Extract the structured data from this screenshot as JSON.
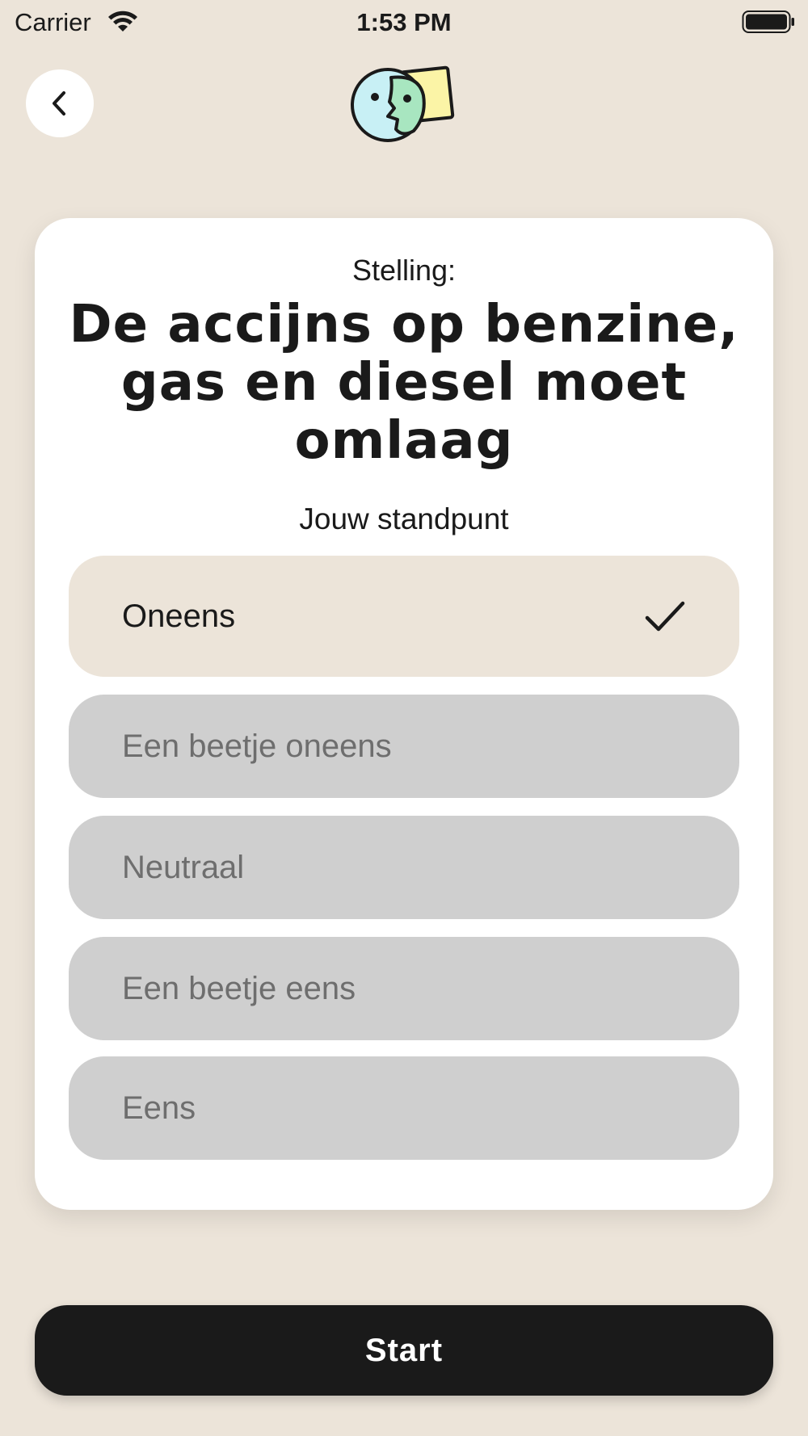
{
  "status_bar": {
    "carrier": "Carrier",
    "time": "1:53 PM"
  },
  "header": {
    "back_icon": "chevron-left-icon",
    "logo_icon": "face-and-card-logo"
  },
  "card": {
    "label": "Stelling:",
    "statement": "De accijns op benzine, gas en diesel moet omlaag",
    "standpunt_label": "Jouw standpunt",
    "options": [
      {
        "label": "Oneens",
        "selected": true
      },
      {
        "label": "Een beetje oneens",
        "selected": false
      },
      {
        "label": "Neutraal",
        "selected": false
      },
      {
        "label": "Een beetje eens",
        "selected": false
      },
      {
        "label": "Eens",
        "selected": false
      }
    ]
  },
  "footer": {
    "start_label": "Start"
  },
  "colors": {
    "background": "#ece4d9",
    "card": "#ffffff",
    "option_inactive": "#cfcfcf",
    "option_selected": "#ece4d9",
    "button": "#1a1a1a"
  }
}
